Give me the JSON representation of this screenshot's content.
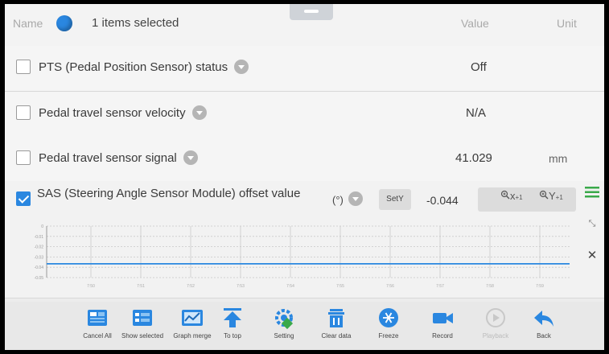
{
  "header": {
    "name_label": "Name",
    "selected_text": "1 items selected",
    "value_label": "Value",
    "unit_label": "Unit"
  },
  "rows": [
    {
      "label": "PTS (Pedal Position Sensor) status",
      "value": "Off",
      "unit": "",
      "checked": false
    },
    {
      "label": "Pedal travel sensor velocity",
      "value": "N/A",
      "unit": "",
      "checked": false
    },
    {
      "label": "Pedal travel sensor signal",
      "value": "41.029",
      "unit": "mm",
      "checked": false
    }
  ],
  "graph_row": {
    "label": "SAS (Steering Angle Sensor Module) offset value",
    "unit": "(°)",
    "sety_label": "SetY",
    "value": "-0.044",
    "zoom_x": "x",
    "zoom_y": "Y",
    "zoom_x_sub": "+1",
    "zoom_y_sub": "+1",
    "checked": true
  },
  "chart_data": {
    "type": "line",
    "title": "",
    "xlabel": "",
    "ylabel": "",
    "x": [
      0,
      1,
      2,
      3,
      4,
      5,
      6,
      7,
      8,
      9,
      10
    ],
    "series": [
      {
        "values": [
          -0.044,
          -0.044,
          -0.044,
          -0.044,
          -0.044,
          -0.044,
          -0.044,
          -0.044,
          -0.044,
          -0.044,
          -0.044
        ]
      }
    ],
    "ylim": [
      -0.06,
      0.0
    ],
    "ytick_labels": [
      "0",
      "-0.01",
      "-0.02",
      "-0.03",
      "-0.04",
      "-0.05"
    ],
    "xtick_labels": [
      "7:50",
      "7:51",
      "7:52",
      "7:53",
      "7:54",
      "7:55",
      "7:56",
      "7:57",
      "7:58",
      "7:59"
    ],
    "grid": true,
    "line_color": "#2a87e0"
  },
  "toolbar": {
    "items": [
      {
        "label": "Cancel All",
        "icon": "cancel-all-icon",
        "enabled": true
      },
      {
        "label": "Show selected",
        "icon": "show-selected-icon",
        "enabled": true
      },
      {
        "label": "Graph merge",
        "icon": "graph-merge-icon",
        "enabled": true
      },
      {
        "label": "To top",
        "icon": "to-top-icon",
        "enabled": true
      },
      {
        "label": "Setting",
        "icon": "setting-icon",
        "enabled": true
      },
      {
        "label": "Clear data",
        "icon": "clear-data-icon",
        "enabled": true
      },
      {
        "label": "Freeze",
        "icon": "freeze-icon",
        "enabled": true
      },
      {
        "label": "Record",
        "icon": "record-icon",
        "enabled": true
      },
      {
        "label": "Playback",
        "icon": "playback-icon",
        "enabled": false
      },
      {
        "label": "Back",
        "icon": "back-icon",
        "enabled": true
      }
    ]
  },
  "colors": {
    "accent": "#2a87e0",
    "background": "#ececec",
    "row_bg": "#f5f5f5"
  }
}
